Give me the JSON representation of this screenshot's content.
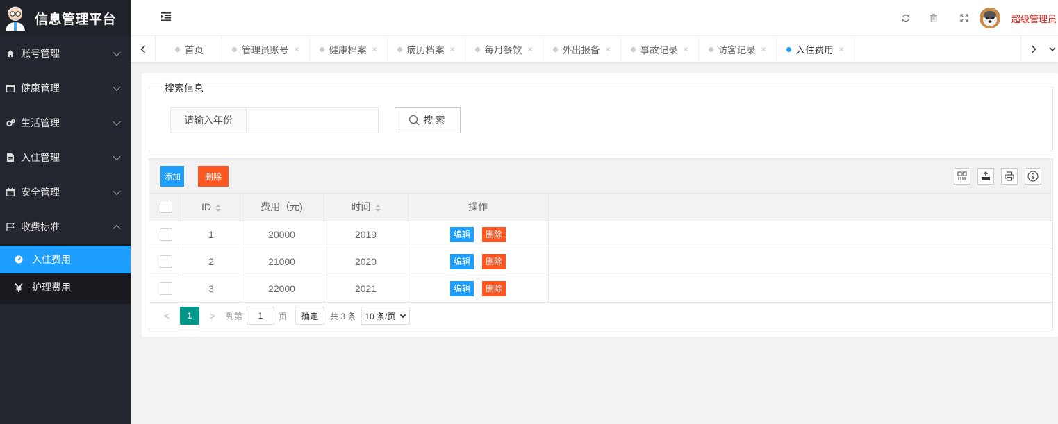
{
  "app": {
    "title": "信息管理平台"
  },
  "sidebar": {
    "items": [
      {
        "label": "账号管理",
        "icon": "home-icon",
        "expanded": false
      },
      {
        "label": "健康管理",
        "icon": "window-icon",
        "expanded": false
      },
      {
        "label": "生活管理",
        "icon": "gears-icon",
        "expanded": false
      },
      {
        "label": "入住管理",
        "icon": "file-icon",
        "expanded": false
      },
      {
        "label": "安全管理",
        "icon": "calendar-icon",
        "expanded": false
      },
      {
        "label": "收费标准",
        "icon": "flag-icon",
        "expanded": true
      }
    ],
    "sub_items": [
      {
        "label": "入住费用",
        "icon": "dashboard-icon",
        "active": true
      },
      {
        "label": "护理费用",
        "icon": "yen-icon",
        "active": false
      }
    ]
  },
  "header": {
    "user_name": "超级管理员",
    "icons": [
      "refresh-icon",
      "trash-icon",
      "fullscreen-icon"
    ]
  },
  "tabs": [
    {
      "label": "首页",
      "closable": false,
      "active": false
    },
    {
      "label": "管理员账号",
      "closable": true,
      "active": false
    },
    {
      "label": "健康档案",
      "closable": true,
      "active": false
    },
    {
      "label": "病历档案",
      "closable": true,
      "active": false
    },
    {
      "label": "每月餐饮",
      "closable": true,
      "active": false
    },
    {
      "label": "外出报备",
      "closable": true,
      "active": false
    },
    {
      "label": "事故记录",
      "closable": true,
      "active": false
    },
    {
      "label": "访客记录",
      "closable": true,
      "active": false
    },
    {
      "label": "入住费用",
      "closable": true,
      "active": true
    }
  ],
  "tab_close_glyph": "×",
  "search": {
    "legend": "搜索信息",
    "label": "请输入年份",
    "value": "",
    "button": "搜索"
  },
  "toolbar": {
    "add_label": "添加",
    "delete_label": "删除"
  },
  "table": {
    "headers": [
      "ID",
      "费用（元)",
      "时间",
      "操作"
    ],
    "rows": [
      {
        "id": "1",
        "fee": "20000",
        "year": "2019"
      },
      {
        "id": "2",
        "fee": "21000",
        "year": "2020"
      },
      {
        "id": "3",
        "fee": "22000",
        "year": "2021"
      }
    ],
    "edit_label": "编辑",
    "delete_label": "删除"
  },
  "pager": {
    "current": "1",
    "goto_prefix": "到第",
    "goto_value": "1",
    "goto_suffix": "页",
    "confirm": "确定",
    "total": "共 3 条",
    "page_size": "10 条/页"
  },
  "colors": {
    "primary": "#1e9fff",
    "danger": "#ff5722",
    "pager_active": "#009688",
    "sidebar_bg": "#23262e",
    "user_name": "#e2231a"
  }
}
